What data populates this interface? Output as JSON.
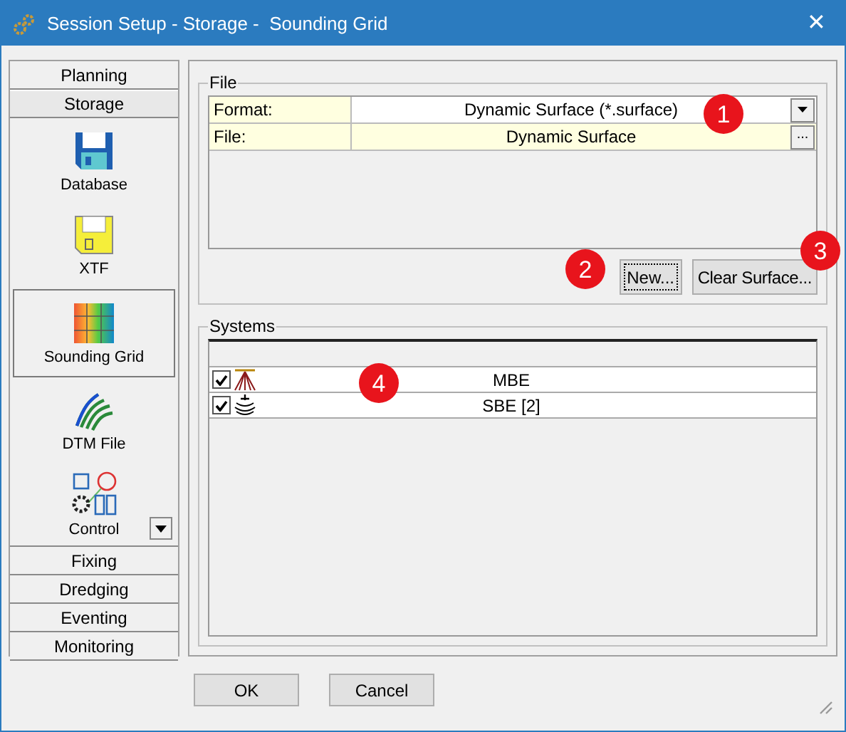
{
  "window": {
    "title": "Session Setup - Storage -  Sounding Grid",
    "close": "✕"
  },
  "sidebar": {
    "sections": [
      {
        "label": "Planning",
        "expanded": false
      },
      {
        "label": "Storage",
        "expanded": true,
        "items": [
          {
            "label": "Database",
            "selected": false
          },
          {
            "label": "XTF",
            "selected": false
          },
          {
            "label": "Sounding Grid",
            "selected": true
          },
          {
            "label": "DTM File",
            "selected": false
          },
          {
            "label": "Control",
            "selected": false
          }
        ]
      },
      {
        "label": "Fixing",
        "expanded": false
      },
      {
        "label": "Dredging",
        "expanded": false
      },
      {
        "label": "Eventing",
        "expanded": false
      },
      {
        "label": "Monitoring",
        "expanded": false
      }
    ]
  },
  "file_group": {
    "title": "File",
    "rows": [
      {
        "kind": "dropdown",
        "label": "Format:",
        "value": "Dynamic Surface (*.surface)"
      },
      {
        "kind": "browse",
        "label": "File:",
        "value": "Dynamic Surface",
        "button": "..."
      }
    ],
    "buttons": [
      {
        "label": "New...",
        "focused": true
      },
      {
        "label": "Clear Surface...",
        "focused": false
      }
    ]
  },
  "systems_group": {
    "title": "Systems",
    "rows": [
      {
        "name": "MBE",
        "checked": true
      },
      {
        "name": "SBE [2]",
        "checked": true
      }
    ]
  },
  "markers": [
    "1",
    "2",
    "3",
    "4"
  ],
  "buttons": [
    "OK",
    "Cancel"
  ]
}
